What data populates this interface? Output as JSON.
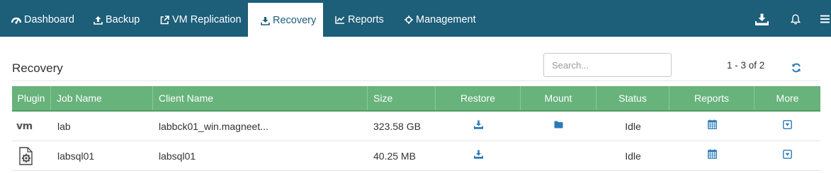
{
  "nav": {
    "items": [
      {
        "label": "Dashboard",
        "icon": "dashboard-icon"
      },
      {
        "label": "Backup",
        "icon": "upload-icon"
      },
      {
        "label": "VM Replication",
        "icon": "external-link-icon"
      },
      {
        "label": "Recovery",
        "icon": "download-icon",
        "active": true
      },
      {
        "label": "Reports",
        "icon": "line-chart-icon"
      },
      {
        "label": "Management",
        "icon": "crosshair-icon"
      }
    ],
    "right_icons": [
      "download-tray-icon",
      "bell-icon",
      "menu-icon"
    ]
  },
  "page": {
    "title": "Recovery",
    "search_placeholder": "Search...",
    "pagination": "1 - 3 of 2"
  },
  "table": {
    "headers": {
      "plugin": "Plugin",
      "job_name": "Job Name",
      "client_name": "Client Name",
      "size": "Size",
      "restore": "Restore",
      "mount": "Mount",
      "status": "Status",
      "reports": "Reports",
      "more": "More"
    },
    "rows": [
      {
        "plugin": "vm",
        "job_name": "lab",
        "client_name": "labbck01_win.magneet...",
        "size": "323.58 GB",
        "has_mount": true,
        "status": "Idle"
      },
      {
        "plugin": "sql-gear-document-icon",
        "job_name": "labsql01",
        "client_name": "labsql01",
        "size": "40.25 MB",
        "has_mount": false,
        "status": "Idle"
      }
    ]
  },
  "colors": {
    "nav_bg": "#1d5e79",
    "header_green": "#67b37b",
    "icon_blue": "#2a7ab8"
  }
}
